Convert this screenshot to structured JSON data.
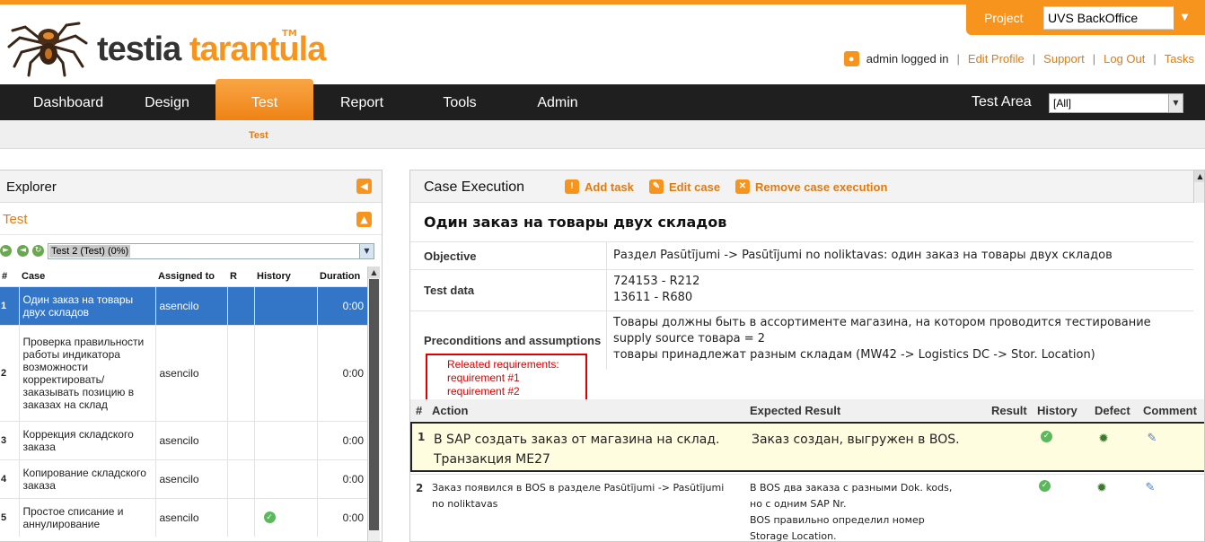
{
  "header": {
    "logo_word1": "testia",
    "logo_word2": "tarantula",
    "logo_tm": "TM",
    "project_label": "Project",
    "project_value": "UVS BackOffice",
    "user_text": "admin logged in",
    "links": [
      "Edit Profile",
      "Support",
      "Log Out",
      "Tasks"
    ]
  },
  "nav": {
    "items": [
      "Dashboard",
      "Design",
      "Test",
      "Report",
      "Tools",
      "Admin"
    ],
    "active": "Test",
    "test_area_label": "Test Area",
    "test_area_value": "[All]",
    "subnav_item": "Test"
  },
  "explorer": {
    "title": "Explorer",
    "subtitle": "Test",
    "selected_test": "Test 2 (Test) (0%)",
    "columns": [
      "#",
      "Case",
      "Assigned to",
      "R",
      "History",
      "Duration"
    ],
    "rows": [
      {
        "num": "1",
        "case": "Один заказ на товары двух складов",
        "assigned": "asencilo",
        "r": "",
        "history": "",
        "duration": "0:00"
      },
      {
        "num": "2",
        "case": "Проверка правильности работы индикатора возможности корректировать/ заказывать позицию в заказах на склад",
        "assigned": "asencilo",
        "r": "",
        "history": "",
        "duration": "0:00"
      },
      {
        "num": "3",
        "case": "Коррекция складского заказа",
        "assigned": "asencilo",
        "r": "",
        "history": "",
        "duration": "0:00"
      },
      {
        "num": "4",
        "case": "Копирование складского заказа",
        "assigned": "asencilo",
        "r": "",
        "history": "",
        "duration": "0:00"
      },
      {
        "num": "5",
        "case": "Простое списание и аннулирование",
        "assigned": "asencilo",
        "r": "",
        "history": "passed",
        "duration": "0:00"
      }
    ]
  },
  "case_panel": {
    "title": "Case Execution",
    "actions": [
      "Add task",
      "Edit case",
      "Remove case execution"
    ],
    "case_title": "Один заказ на товары двух складов",
    "objective_label": "Objective",
    "objective": "Раздел Pasūtījumi -> Pasūtījumi no noliktavas: один заказ на товары двух складов",
    "test_data_label": "Test data",
    "test_data": [
      "724153 - R212",
      "13611 - R680"
    ],
    "preconditions_label": "Preconditions and assumptions",
    "preconditions": [
      "Товары должны быть в ассортименте магазина, на котором проводится тестирование",
      "supply source товара = 2",
      "товары принадлежат разным складам (MW42 -> Logistics DC -> Stor. Location)"
    ],
    "requirements": [
      "Releated requirements:",
      "requirement #1",
      "requirement #2"
    ],
    "step_columns": [
      "#",
      "Action",
      "Expected Result",
      "Result",
      "History",
      "Defect",
      "Comment"
    ],
    "steps": [
      {
        "num": "1",
        "action": "В SAP создать заказ от магазина на склад. Транзакция ME27",
        "expected": "Заказ создан, выгружен в BOS."
      },
      {
        "num": "2",
        "action": "Заказ появился в BOS в разделе Pasūtījumi -> Pasūtījumi no noliktavas",
        "expected": "В BOS два заказа с разными Dok. kods, но с одним SAP Nr.",
        "expected2": "BOS правильно определил номер Storage Location."
      }
    ]
  },
  "colors": {
    "accent": "#f7941d",
    "nav_bg": "#1f1f1f",
    "selected_row": "#3375c6",
    "requirement_box": "#dd0000"
  }
}
